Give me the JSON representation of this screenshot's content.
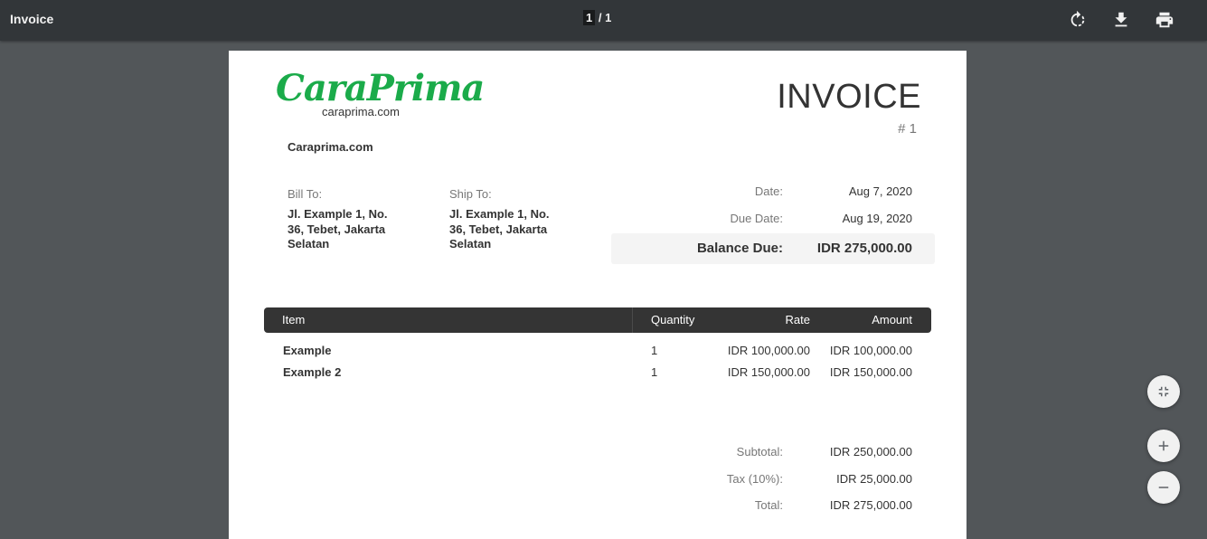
{
  "toolbar": {
    "title": "Invoice",
    "page_current": "1",
    "page_total": "/ 1",
    "icons": [
      "rotate-icon",
      "download-icon",
      "print-icon"
    ]
  },
  "invoice": {
    "logo": {
      "brand": "CaraPrima",
      "sub": "caraprima.com",
      "color": "#1bab4a"
    },
    "company": "Caraprima.com",
    "title": "INVOICE",
    "number": "# 1",
    "bill_to_label": "Bill To:",
    "bill_to": "Jl. Example 1, No. 36, Tebet, Jakarta Selatan",
    "ship_to_label": "Ship To:",
    "ship_to": "Jl. Example 1, No. 36, Tebet, Jakarta Selatan",
    "date_label": "Date:",
    "date": "Aug 7, 2020",
    "due_date_label": "Due Date:",
    "due_date": "Aug 19, 2020",
    "balance_label": "Balance Due:",
    "balance": "IDR 275,000.00",
    "columns": {
      "item": "Item",
      "quantity": "Quantity",
      "rate": "Rate",
      "amount": "Amount"
    },
    "items": [
      {
        "name": "Example",
        "quantity": "1",
        "rate": "IDR 100,000.00",
        "amount": "IDR 100,000.00"
      },
      {
        "name": "Example 2",
        "quantity": "1",
        "rate": "IDR 150,000.00",
        "amount": "IDR 150,000.00"
      }
    ],
    "subtotal_label": "Subtotal:",
    "subtotal": "IDR 250,000.00",
    "tax_label": "Tax (10%):",
    "tax": "IDR 25,000.00",
    "total_label": "Total:",
    "total": "IDR 275,000.00"
  },
  "zoom_controls": [
    "fit-page-icon",
    "zoom-in-icon",
    "zoom-out-icon"
  ]
}
